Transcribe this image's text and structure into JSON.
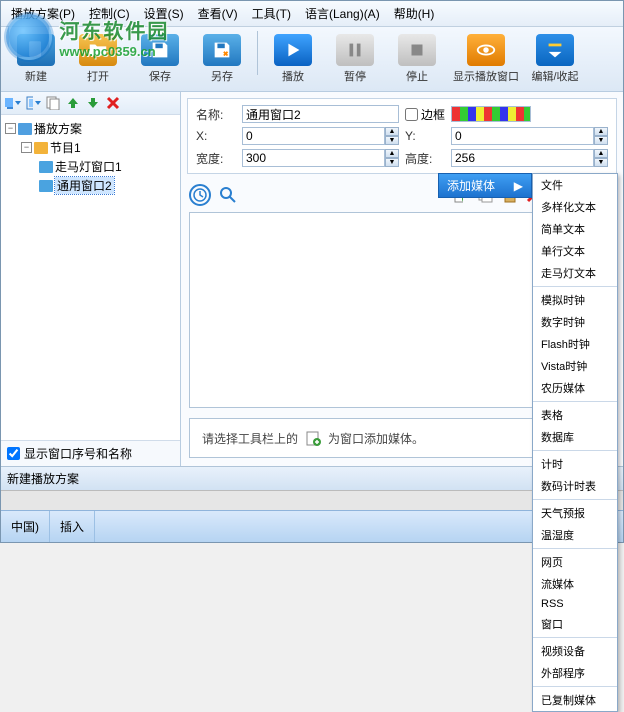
{
  "menu": {
    "items": [
      "播放方案(P)",
      "控制(C)",
      "设置(S)",
      "查看(V)",
      "工具(T)",
      "语言(Lang)(A)",
      "帮助(H)"
    ]
  },
  "toolbar": {
    "new": "新建",
    "open": "打开",
    "save": "保存",
    "saveas": "另存",
    "play": "播放",
    "pause": "暂停",
    "stop": "停止",
    "show": "显示播放窗口",
    "collapse": "编辑/收起"
  },
  "tree": {
    "root": "播放方案",
    "program": "节目1",
    "marquee": "走马灯窗口1",
    "general": "通用窗口2"
  },
  "showSeq": "显示窗口序号和名称",
  "prop": {
    "name_label": "名称:",
    "name_value": "通用窗口2",
    "border_label": "边框",
    "x_label": "X:",
    "x_value": "0",
    "y_label": "Y:",
    "y_value": "0",
    "w_label": "宽度:",
    "w_value": "300",
    "h_label": "高度:",
    "h_value": "256"
  },
  "hint": {
    "pre": "请选择工具栏上的",
    "post": "为窗口添加媒体。"
  },
  "status": "新建播放方案",
  "bottom": {
    "lang": "中国)",
    "insert": "插入"
  },
  "submenu_head": "添加媒体",
  "context_menu": {
    "groups": [
      [
        "文件",
        "多样化文本",
        "简单文本",
        "单行文本",
        "走马灯文本"
      ],
      [
        "模拟时钟",
        "数字时钟",
        "Flash时钟",
        "Vista时钟",
        "农历媒体"
      ],
      [
        "表格",
        "数据库"
      ],
      [
        "计时",
        "数码计时表"
      ],
      [
        "天气预报",
        "温湿度"
      ],
      [
        "网页",
        "流媒体",
        "RSS",
        "窗口"
      ],
      [
        "视频设备",
        "外部程序"
      ],
      [
        "已复制媒体"
      ]
    ]
  },
  "watermark": {
    "cn": "河东软件园",
    "url": "www.pc0359.cn"
  }
}
